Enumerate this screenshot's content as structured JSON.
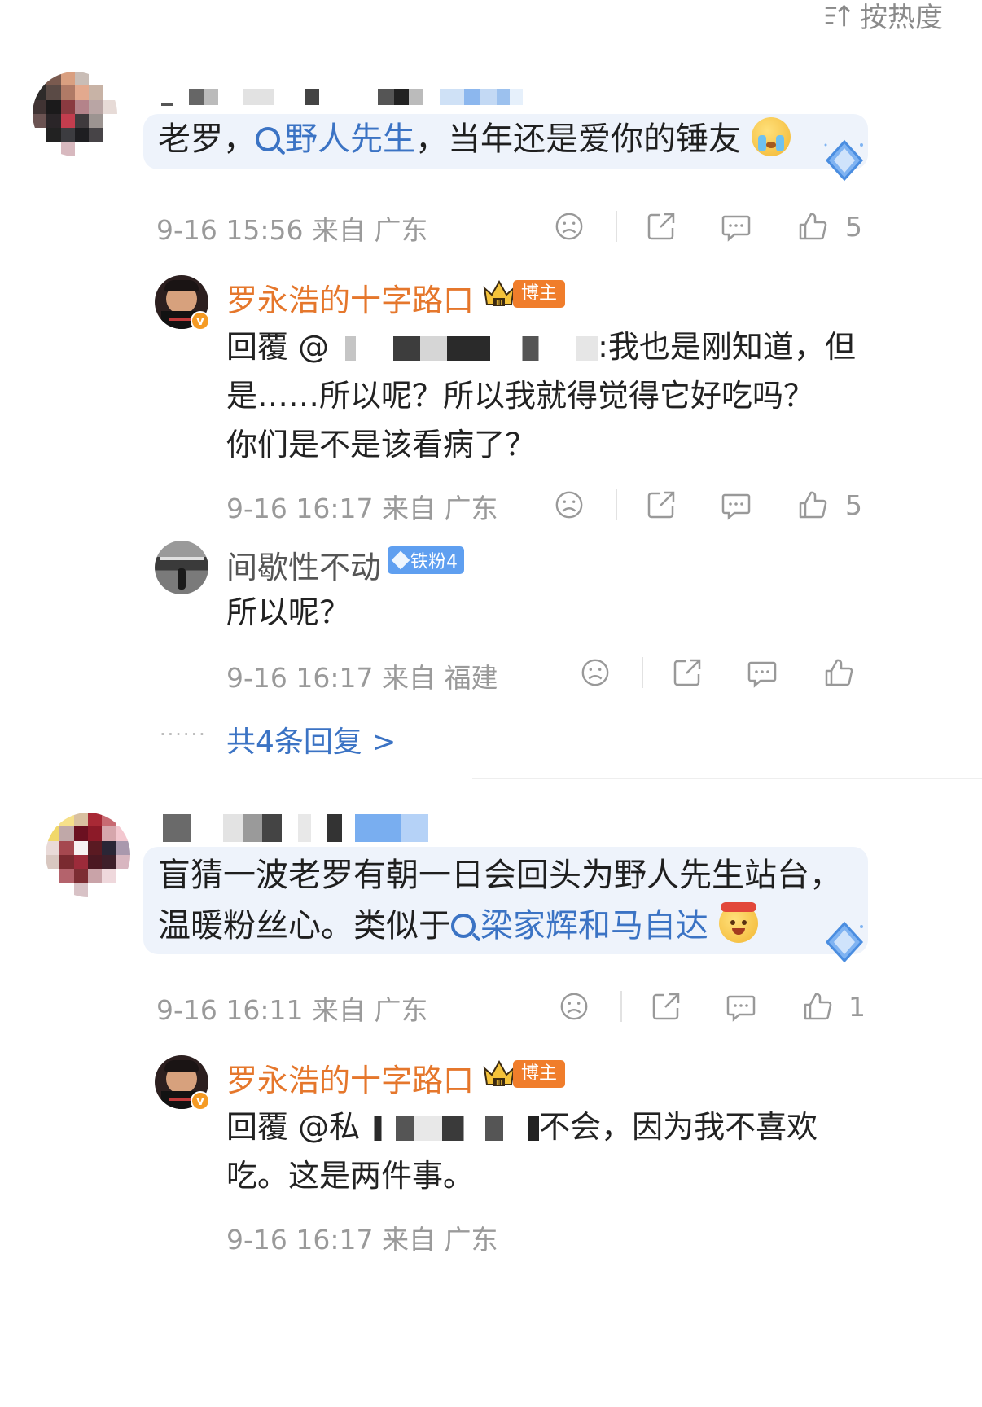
{
  "sort": {
    "label": "按热度"
  },
  "comments": [
    {
      "text_before": "老罗，",
      "topic": "野人先生",
      "text_after": "，当年还是爱你的锤友",
      "meta": "9-16 15:56 来自 广东",
      "likes": "5",
      "replies": [
        {
          "author": "罗永浩的十字路口",
          "badge": "博主",
          "text_line1": "回覆 @",
          "text_line1_end": ":我也是刚知道，但",
          "text_line2": "是……所以呢？所以我就得觉得它好吃吗？",
          "text_line3": "你们是不是该看病了？",
          "meta": "9-16 16:17 来自 广东",
          "likes": "5"
        },
        {
          "author": "间歇性不动",
          "badge": "铁粉4",
          "text": "所以呢？",
          "meta": "9-16 16:17 来自 福建",
          "likes": ""
        }
      ],
      "more_replies": "共4条回复 >"
    },
    {
      "text_line1": "盲猜一波老罗有朝一日会回头为野人先生站台，",
      "text_line2_before": "温暖粉丝心。类似于",
      "topic": "梁家辉和马自达",
      "meta": "9-16 16:11 来自 广东",
      "likes": "1",
      "replies": [
        {
          "author": "罗永浩的十字路口",
          "badge": "博主",
          "text_line1": "回覆 @私",
          "text_line1_end": "不会，因为我不喜欢",
          "text_line2": "吃。这是两件事。",
          "meta": "9-16 16:17 来自 广东"
        }
      ]
    }
  ],
  "colors": {
    "accent_orange": "#e5772c",
    "link_blue": "#3b73c4",
    "meta_gray": "#9a9a9a"
  },
  "icons": [
    "sort-icon",
    "dislike-face-icon",
    "share-icon",
    "comment-icon",
    "like-thumb-icon",
    "crown-icon",
    "diamond-icon",
    "search-icon"
  ]
}
